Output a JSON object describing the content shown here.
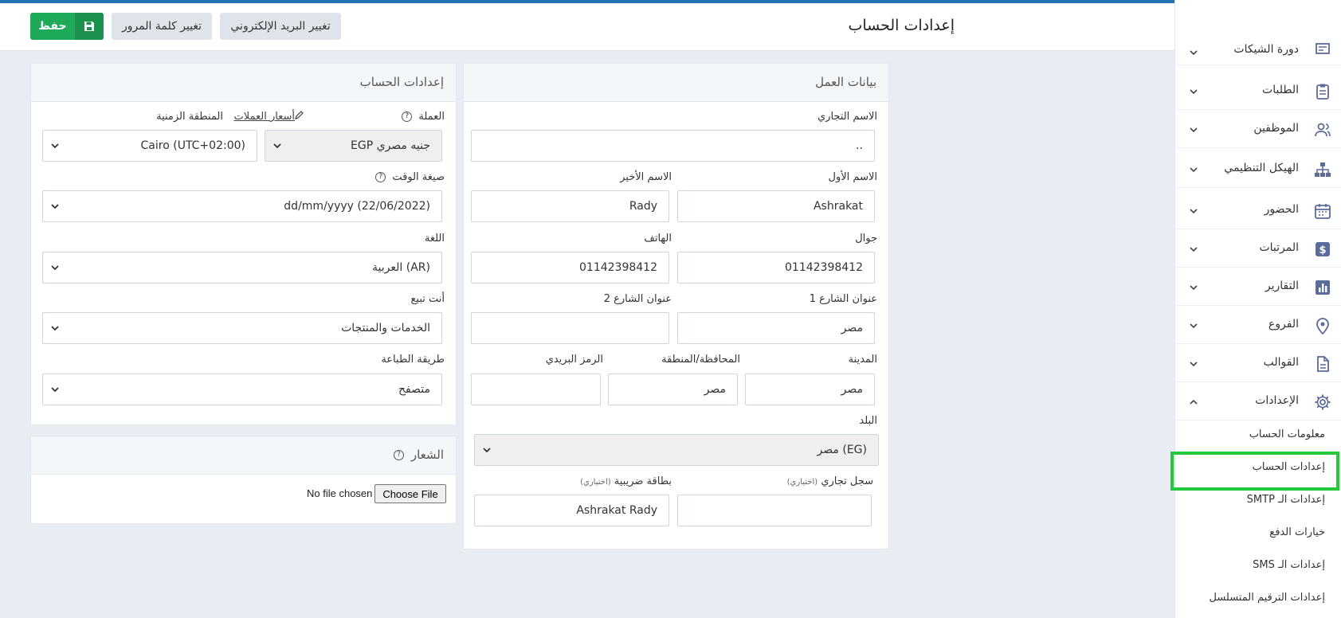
{
  "header": {
    "title": "إعدادات الحساب",
    "change_email": "تغيير البريد الإلكتروني",
    "change_password": "تغيير كلمة المرور",
    "save": "حفظ"
  },
  "work_panel": {
    "title": "بيانات العمل",
    "business_name_label": "الاسم التجاري",
    "business_name_value": "..",
    "first_name_label": "الاسم الأول",
    "first_name_value": "Ashrakat",
    "last_name_label": "الاسم الأخير",
    "last_name_value": "Rady",
    "mobile_label": "جوال",
    "mobile_value": "01142398412",
    "phone_label": "الهاتف",
    "phone_value": "01142398412",
    "street1_label": "عنوان الشارع 1",
    "street1_value": "مصر",
    "street2_label": "عنوان الشارع 2",
    "street2_value": "",
    "city_label": "المدينة",
    "city_value": "مصر",
    "state_label": "المحافظة/المنطقة",
    "state_value": "مصر",
    "zip_label": "الرمز البريدي",
    "zip_value": "",
    "country_label": "البلد",
    "country_value": "مصر (EG)",
    "commercial_reg_label": "سجل تجاري",
    "commercial_reg_optional": "(اختياري)",
    "commercial_reg_value": "",
    "tax_card_label": "بطاقة ضريبية",
    "tax_card_optional": "(اختياري)",
    "tax_card_value": "Ashrakat Rady"
  },
  "account_panel": {
    "title": "إعدادات الحساب",
    "currency_label": "العملة",
    "currency_rates_link": "أسعار العملات",
    "currency_value": "EGP جنيه مصري",
    "timezone_label": "المنطقة الزمنية",
    "timezone_value": "Cairo (UTC+02:00)",
    "time_format_label": "صيغة الوقت",
    "time_format_value": "dd/mm/yyyy (22/06/2022)",
    "language_label": "اللغة",
    "language_value": "العربية (AR)",
    "you_sell_label": "أنت تبيع",
    "you_sell_value": "الخدمات والمنتجات",
    "print_method_label": "طريقة الطباعة",
    "print_method_value": "متصفح",
    "qmark": "?"
  },
  "logo_panel": {
    "title": "الشعار",
    "choose_file": "Choose File",
    "no_file": "No file chosen"
  },
  "sidebar": {
    "items": [
      {
        "label": "دورة الشيكات",
        "icon": "cheque-icon"
      },
      {
        "label": "الطلبات",
        "icon": "clipboard-icon"
      },
      {
        "label": "الموظفين",
        "icon": "users-icon"
      },
      {
        "label": "الهيكل التنظيمي",
        "icon": "org-chart-icon"
      },
      {
        "label": "الحضور",
        "icon": "calendar-icon"
      },
      {
        "label": "المرتبات",
        "icon": "dollar-icon"
      },
      {
        "label": "التقارير",
        "icon": "bar-chart-icon"
      },
      {
        "label": "الفروع",
        "icon": "map-pin-icon"
      },
      {
        "label": "القوالب",
        "icon": "file-icon"
      },
      {
        "label": "الإعدادات",
        "icon": "gear-icon"
      }
    ],
    "subitems": [
      "معلومات الحساب",
      "إعدادات الحساب",
      "إعدادات الـ SMTP",
      "خيارات الدفع",
      "إعدادات الـ SMS",
      "إعدادات الترقيم المتسلسل"
    ]
  },
  "colors": {
    "accent": "#2173b8",
    "save": "#1fa95a",
    "highlight": "#22c93a",
    "sidebar_icon": "#5b6b9a"
  }
}
